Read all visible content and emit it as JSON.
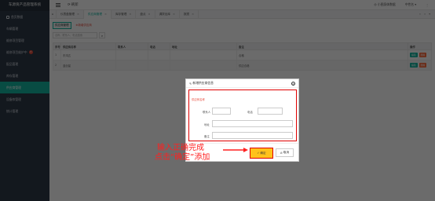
{
  "app": {
    "title": "车源资产品管理系统"
  },
  "sidebar": {
    "items": [
      {
        "label": "首页数据",
        "icon": "home-icon"
      },
      {
        "label": "车辆管理"
      },
      {
        "label": "维修项目管理"
      },
      {
        "label": "维修项目维护中",
        "badge": "7"
      },
      {
        "label": "配品管理"
      },
      {
        "label": "库存管理"
      },
      {
        "label": "供应商管理"
      },
      {
        "label": "设备款管理"
      },
      {
        "label": "统计管理"
      }
    ]
  },
  "topbar": {
    "refresh_label": "刷新",
    "user_center": "小图身体数据",
    "user": "中性名",
    "colors": {
      "accent": "#13b5a0",
      "sidebar_bg": "#2f3a48",
      "danger": "#e84c3d"
    }
  },
  "tabs": [
    {
      "label": "仪表盘管理"
    },
    {
      "label": "供应商管理",
      "active": true
    },
    {
      "label": "库存管理"
    },
    {
      "label": "盘点"
    },
    {
      "label": "调拨出库"
    },
    {
      "label": "报损"
    }
  ],
  "main": {
    "subtabs": [
      {
        "label": "供应商管理",
        "active": true
      },
      {
        "label": "新增供应商"
      }
    ],
    "search": {
      "placeholder": "名称、联系人、电话搜索"
    },
    "table": {
      "columns": [
        "序号",
        "供应商名称",
        "联系人",
        "电话",
        "地址",
        "备注",
        "操作"
      ],
      "rows": [
        {
          "index": "1",
          "name": "东鸿达",
          "contact": "",
          "phone": "",
          "address": "",
          "remark": "合格"
        },
        {
          "index": "2",
          "name": "蓝创星",
          "contact": "",
          "phone": "",
          "address": "",
          "remark": "供应合格"
        }
      ],
      "ops": {
        "edit": "编辑",
        "delete": "删除"
      }
    }
  },
  "dialog": {
    "title": "新增供应商信息",
    "fields": {
      "name_label": "供应商名称",
      "contact_label": "联系人",
      "phone_label": "电话",
      "address_label": "地址",
      "remark_label": "备注"
    },
    "ok_label": "确定",
    "cancel_label": "取消"
  },
  "annotation": {
    "line1": "输入正确完成",
    "line2": "点击“确定”添加"
  }
}
